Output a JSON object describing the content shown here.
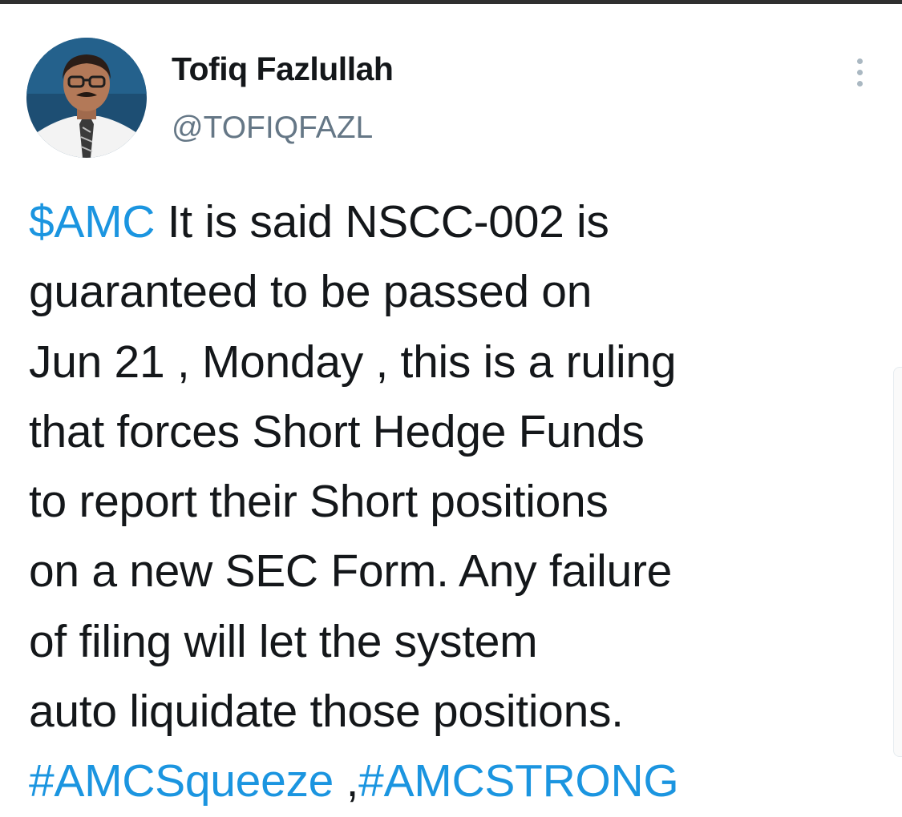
{
  "author": {
    "display_name": "Tofiq Fazlullah",
    "handle": "@TOFIQFAZL",
    "avatar_icon": "profile-photo"
  },
  "menu": {
    "icon": "more-vertical-icon"
  },
  "tweet": {
    "lines": [
      [
        {
          "text": "$AMC",
          "link": true
        },
        {
          "text": " It is said NSCC-002 is",
          "link": false
        }
      ],
      [
        {
          "text": "guaranteed to be passed on",
          "link": false
        }
      ],
      [
        {
          "text": "Jun 21 , Monday , this is a ruling",
          "link": false
        }
      ],
      [
        {
          "text": "that forces Short Hedge Funds",
          "link": false
        }
      ],
      [
        {
          "text": "to report their Short positions",
          "link": false
        }
      ],
      [
        {
          "text": "on a new SEC Form. Any failure",
          "link": false
        }
      ],
      [
        {
          "text": "of filing will let the system",
          "link": false
        }
      ],
      [
        {
          "text": "auto liquidate those positions.",
          "link": false
        }
      ],
      [
        {
          "text": "#AMCSqueeze",
          "link": true
        },
        {
          "text": " ,",
          "link": false
        },
        {
          "text": "#AMCSTRONG",
          "link": true
        }
      ]
    ]
  },
  "colors": {
    "link": "#1b95e0",
    "text": "#14171a",
    "secondary": "#657786"
  }
}
